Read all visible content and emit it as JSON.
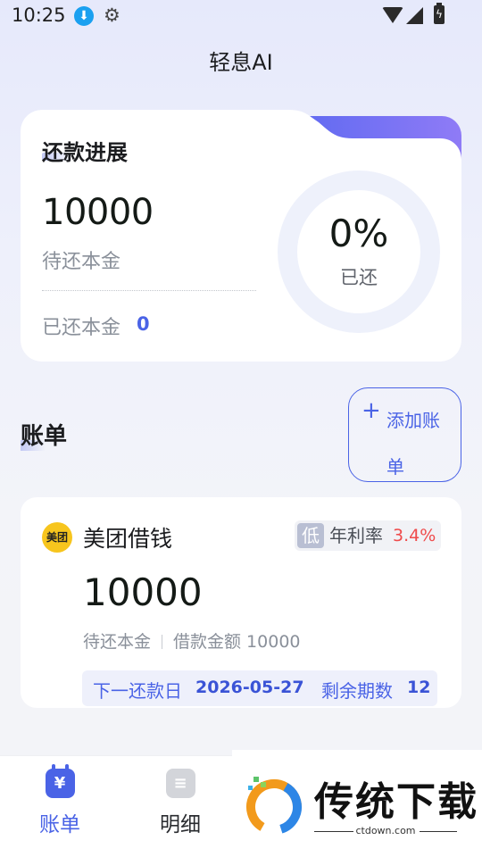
{
  "status_bar": {
    "time": "10:25",
    "download_glyph": "⬇",
    "gear_glyph": "⚙",
    "battery_glyph": "ϟ"
  },
  "header": {
    "title": "轻息AI"
  },
  "progress": {
    "title": "还款进展",
    "remaining_principal": "10000",
    "remaining_label": "待还本金",
    "paid_label": "已还本金",
    "paid_value": "0",
    "percent": "0%",
    "percent_label": "已还",
    "progress_fraction": 0
  },
  "bills": {
    "section_title": "账单",
    "add_icon": "+",
    "add_label": "添加账单",
    "items": [
      {
        "brand_logo_text": "美团",
        "name": "美团借钱",
        "risk_badge": "低",
        "rate_label": "年利率",
        "rate_value": "3.4%",
        "remaining_amount": "10000",
        "remaining_label": "待还本金",
        "loan_amount_text": "借款金额 10000",
        "next_due_label": "下一还款日",
        "next_due_date": "2026-05-27",
        "remaining_terms_label": "剩余期数",
        "remaining_terms_value": "12"
      }
    ]
  },
  "bottom_nav": {
    "items": [
      {
        "label": "账单",
        "icon": "yen-calendar-icon",
        "glyph": "¥",
        "active": true
      },
      {
        "label": "明细",
        "icon": "list-icon",
        "glyph": "≡",
        "active": false
      }
    ]
  },
  "watermark": {
    "title": "传统下载",
    "url": "ctdown.com"
  },
  "colors": {
    "accent": "#4a63e6",
    "rate_red": "#ef4b4b",
    "badge_bg": "#b9bfd3",
    "logo_yellow": "#f7c51d"
  }
}
